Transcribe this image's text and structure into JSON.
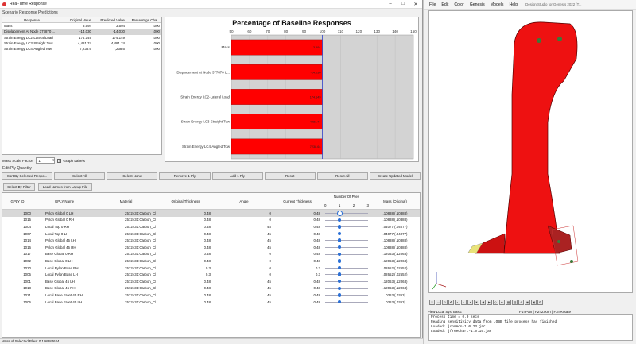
{
  "window": {
    "title": "Real-Time Response"
  },
  "predictions": {
    "section_label": "Scenario Response Predictions",
    "columns": [
      "Response",
      "Original Value",
      "Predicted Value",
      "Percentage Cha..."
    ],
    "rows": [
      {
        "name": "Mass",
        "orig": "3.594",
        "pred": "3.594",
        "pct": ".000"
      },
      {
        "name": "Displacement At Node 377870 ...",
        "orig": "-14.030",
        "pred": "-14.030",
        "pct": ".000"
      },
      {
        "name": "Strain Energy LC2-Lateral Load",
        "orig": "174.149",
        "pred": "174.149",
        "pct": ".000"
      },
      {
        "name": "Strain Energy LC3-Straight Tow",
        "orig": "4,481.74",
        "pred": "4,481.74",
        "pct": ".000"
      },
      {
        "name": "Strain Energy LC4-Angled Tow",
        "orig": "7,238.6",
        "pred": "7,238.6",
        "pct": ".000"
      }
    ]
  },
  "chart_data": {
    "type": "bar",
    "title": "Percentage of Baseline Responses",
    "categories": [
      "Mass",
      "Displacement At Node 377870 L...",
      "Strain Energy LC2-Lateral Load",
      "Strain Energy LC3-Straight Tow",
      "Strain Energy LC4-Angled Tow"
    ],
    "values": [
      100,
      100,
      100,
      100,
      100
    ],
    "bar_labels": [
      "3.594",
      "-14.030",
      "174.149",
      "4481.74",
      "7238.64"
    ],
    "xticks": [
      50,
      60,
      70,
      80,
      90,
      100,
      110,
      120,
      130,
      140,
      150
    ],
    "xlim": [
      50,
      150
    ],
    "reference_line": 100,
    "bar_color": "#ff0000",
    "grid": true,
    "xlabel": "",
    "ylabel": ""
  },
  "controls": {
    "mass_scale_label": "Mass Scale Factor:",
    "mass_scale_value": "1",
    "graph_labels": "Graph Labels"
  },
  "edit": {
    "section_label": "Edit Ply Quantity",
    "buttons": [
      "Sort By Selected Respo...",
      "Select All",
      "Select None",
      "Remove 1 Ply",
      "Add 1 Ply",
      "Reset",
      "Reset All",
      "Create Updated Model"
    ],
    "select_by_filter": "Select By Filter",
    "load_names": "Load Names from Layup File"
  },
  "grid": {
    "columns": [
      "GPLY ID",
      "GPLY Name",
      "Material",
      "Original Thickness",
      "Angle",
      "Current Thickness",
      "Number Of Plies",
      "Mass (Original)"
    ],
    "ply_ticks": [
      "0",
      "1",
      "2",
      "3"
    ],
    "rows": [
      {
        "id": "1000",
        "name": "Pylon Global 0 LH",
        "mat": "2572431:Carbon_Cloth_410...",
        "ot": "0.48",
        "ang": "0",
        "ct": "0.48",
        "plies": 1,
        "mass": ".10888 (.10888)"
      },
      {
        "id": "1015",
        "name": "Pylon Global 0 RH",
        "mat": "2572431:Carbon_Cloth_410...",
        "ot": "0.48",
        "ang": "0",
        "ct": "0.48",
        "plies": 1,
        "mass": ".10888 (.10888)"
      },
      {
        "id": "1004",
        "name": "Local Top 0 RH",
        "mat": "2572431:Carbon_Cloth_410...",
        "ot": "0.48",
        "ang": "45",
        "ct": "0.48",
        "plies": 1,
        "mass": ".04077 (.04077)"
      },
      {
        "id": "1007",
        "name": "Local Top 0 LH",
        "mat": "2572431:Carbon_Cloth_410...",
        "ot": "0.48",
        "ang": "45",
        "ct": "0.48",
        "plies": 1,
        "mass": ".04077 (.04077)"
      },
      {
        "id": "1014",
        "name": "Pylon Global 45 LH",
        "mat": "2572431:Carbon_Cloth_410...",
        "ot": "0.48",
        "ang": "45",
        "ct": "0.48",
        "plies": 1,
        "mass": ".10888 (.10888)"
      },
      {
        "id": "1016",
        "name": "Pylon Global 45 RH",
        "mat": "2572431:Carbon_Cloth_410...",
        "ot": "0.48",
        "ang": "45",
        "ct": "0.48",
        "plies": 1,
        "mass": ".10888 (.10888)"
      },
      {
        "id": "1017",
        "name": "Base Global 0 RH",
        "mat": "2572431:Carbon_Cloth_410...",
        "ot": "0.48",
        "ang": "0",
        "ct": "0.48",
        "plies": 1,
        "mass": ".12063 (.12063)"
      },
      {
        "id": "1002",
        "name": "Base Global 0 LH",
        "mat": "2572431:Carbon_Cloth_410...",
        "ot": "0.48",
        "ang": "0",
        "ct": "0.48",
        "plies": 1,
        "mass": ".12063 (.12063)"
      },
      {
        "id": "1020",
        "name": "Local Pylon Base RH",
        "mat": "2572431:Carbon_Cloth_200...",
        "ot": "0.3",
        "ang": "0",
        "ct": "0.3",
        "plies": 1,
        "mass": ".02652 (.02652)"
      },
      {
        "id": "1005",
        "name": "Local Pylon Base LH",
        "mat": "2572431:Carbon_Cloth_200...",
        "ot": "0.3",
        "ang": "0",
        "ct": "0.3",
        "plies": 1,
        "mass": ".02652 (.02652)"
      },
      {
        "id": "1001",
        "name": "Base Global 45 LH",
        "mat": "2572431:Carbon_Cloth_410...",
        "ot": "0.48",
        "ang": "45",
        "ct": "0.48",
        "plies": 1,
        "mass": ".12063 (.12063)"
      },
      {
        "id": "1018",
        "name": "Base Global 45 RH",
        "mat": "2572431:Carbon_Cloth_410...",
        "ot": "0.48",
        "ang": "45",
        "ct": "0.48",
        "plies": 1,
        "mass": ".12063 (.12063)"
      },
      {
        "id": "1021",
        "name": "Local Base Front 45 RH",
        "mat": "2572431:Carbon_Cloth_410...",
        "ot": "0.48",
        "ang": "45",
        "ct": "0.48",
        "plies": 1,
        "mass": ".0363 (.0363)"
      },
      {
        "id": "1006",
        "name": "Local Base Front 45 LH",
        "mat": "2572431:Carbon_Cloth_410...",
        "ot": "0.48",
        "ang": "45",
        "ct": "0.48",
        "plies": 1,
        "mass": ".0363 (.0363)"
      }
    ],
    "selected_row": 0
  },
  "status": "Mass of Selected Plies: 0.108884624",
  "right": {
    "menu": [
      "File",
      "Edit",
      "Color",
      "Genesis",
      "Models",
      "Help"
    ],
    "design_studio": "Design Studio for Genesis 2022 [T...",
    "view_label": "View Local Sys: Basic",
    "help": "F1=Pan | F2=Zoom | F3=Rotate",
    "console": [
      "Process time = 0.0 secs",
      "Reading sensitivity data from .OBB file process has finished",
      "Loaded: jcommon-1.0.23.jar",
      "Loaded: jfreechart-1.0.19.jar"
    ],
    "colors": {
      "model": "#ee1111"
    }
  }
}
